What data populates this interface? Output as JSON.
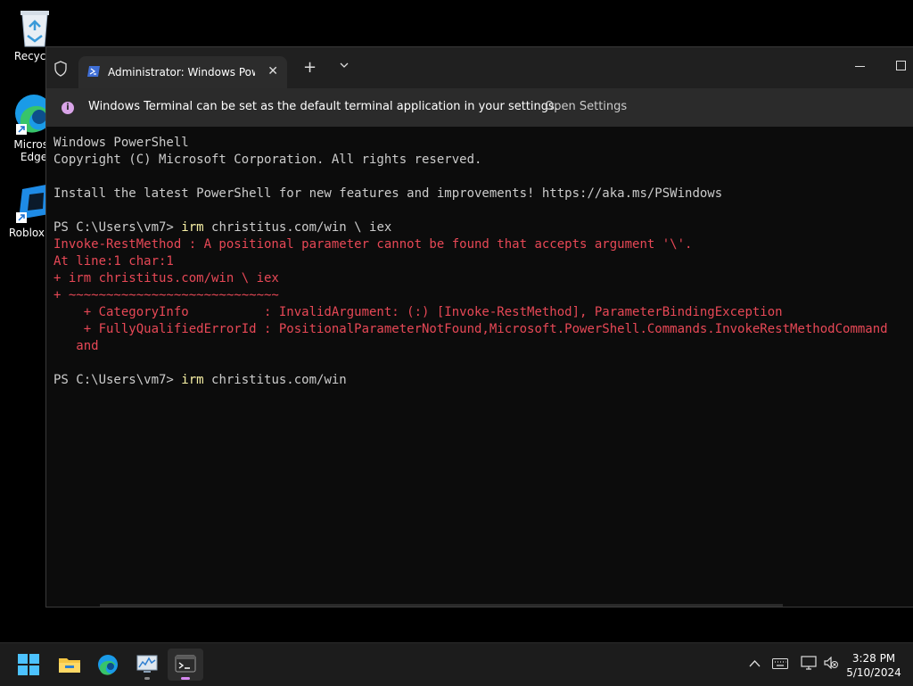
{
  "desktop": {
    "icons": [
      {
        "label": "Recycle Bin",
        "visible_label": "Recycle"
      },
      {
        "label": "Microsoft Edge",
        "visible_label_1": "Microsc",
        "visible_label_2": "Edge"
      },
      {
        "label": "Roblox Studio",
        "visible_label": "Roblox St"
      }
    ]
  },
  "window": {
    "tab_title": "Administrator: Windows Powe",
    "new_tab": "+",
    "close_tab": "✕",
    "infobar": {
      "message": "Windows Terminal can be set as the default terminal application in your settings.",
      "action": "Open Settings",
      "info_glyph": "i"
    }
  },
  "terminal": {
    "lines": [
      {
        "text": "Windows PowerShell",
        "style": "normal"
      },
      {
        "text": "Copyright (C) Microsoft Corporation. All rights reserved.",
        "style": "normal"
      },
      {
        "text": "",
        "style": "normal"
      },
      {
        "text": "Install the latest PowerShell for new features and improvements! https://aka.ms/PSWindows",
        "style": "normal"
      },
      {
        "text": "",
        "style": "normal"
      },
      {
        "prompt": "PS C:\\Users\\vm7> ",
        "cmd": "irm",
        "args": " christitus.com/win \\ iex",
        "style": "prompt"
      },
      {
        "text": "Invoke-RestMethod : A positional parameter cannot be found that accepts argument '\\'.",
        "style": "error"
      },
      {
        "text": "At line:1 char:1",
        "style": "error"
      },
      {
        "text": "+ irm christitus.com/win \\ iex",
        "style": "error"
      },
      {
        "text": "+ ~~~~~~~~~~~~~~~~~~~~~~~~~~~~",
        "style": "error"
      },
      {
        "text": "    + CategoryInfo          : InvalidArgument: (:) [Invoke-RestMethod], ParameterBindingException",
        "style": "error"
      },
      {
        "text": "    + FullyQualifiedErrorId : PositionalParameterNotFound,Microsoft.PowerShell.Commands.InvokeRestMethodCommand",
        "style": "error"
      },
      {
        "text": "   and",
        "style": "error"
      },
      {
        "text": "",
        "style": "normal"
      },
      {
        "prompt": "PS C:\\Users\\vm7> ",
        "cmd": "irm",
        "args": " christitus.com/win",
        "style": "prompt"
      }
    ]
  },
  "taskbar": {
    "apps": [
      "Start",
      "File Explorer",
      "Microsoft Edge",
      "Performance Monitor",
      "Terminal"
    ],
    "time": "3:28 PM",
    "date": "5/10/2024"
  },
  "colors": {
    "error": "#e74856",
    "command": "#f9f1a5",
    "text": "#cccccc",
    "accent": "#d688f0"
  }
}
